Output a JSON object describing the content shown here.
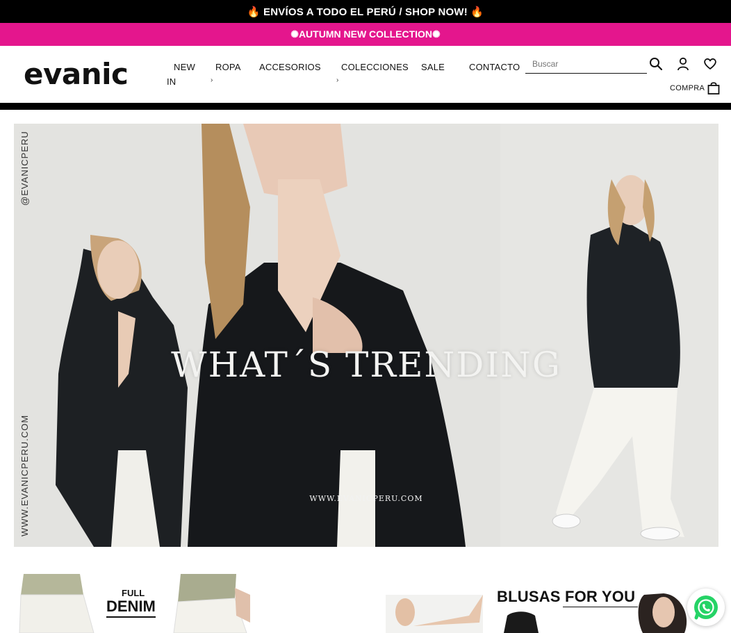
{
  "announcement": {
    "text": "🔥 ENVÍOS A TODO EL PERÚ / SHOP NOW! 🔥"
  },
  "promo": {
    "text": "✺AUTUMN NEW COLLECTION✺"
  },
  "header": {
    "logo": "evanic",
    "nav": [
      {
        "label": "NEW IN",
        "has_submenu": true
      },
      {
        "label": "ROPA",
        "has_submenu": false
      },
      {
        "label": "ACCESORIOS",
        "has_submenu": true
      },
      {
        "label": "COLECCIONES",
        "has_submenu": false
      },
      {
        "label": "SALE",
        "has_submenu": false
      },
      {
        "label": "CONTACTO",
        "has_submenu": false
      }
    ],
    "nav_line1": "NEW",
    "nav_line2": "IN",
    "search_placeholder": "Buscar",
    "cart_label": "COMPRA"
  },
  "hero": {
    "title": "WHAT´S TRENDING",
    "url_caption": "WWW.EVANICPERU.COM",
    "side_top": "@EVANICPERU",
    "side_bottom": "WWW.EVANICPERU.COM"
  },
  "tiles": [
    {
      "heading_line1": "FULL",
      "heading_line2": "DENIM"
    },
    {
      "heading": "BLUSAS FOR YOU"
    }
  ],
  "colors": {
    "pink": "#e4168d",
    "black": "#000000",
    "whatsapp": "#25d366"
  },
  "icons": [
    "search-icon",
    "user-icon",
    "heart-icon",
    "bag-icon",
    "whatsapp-icon"
  ]
}
